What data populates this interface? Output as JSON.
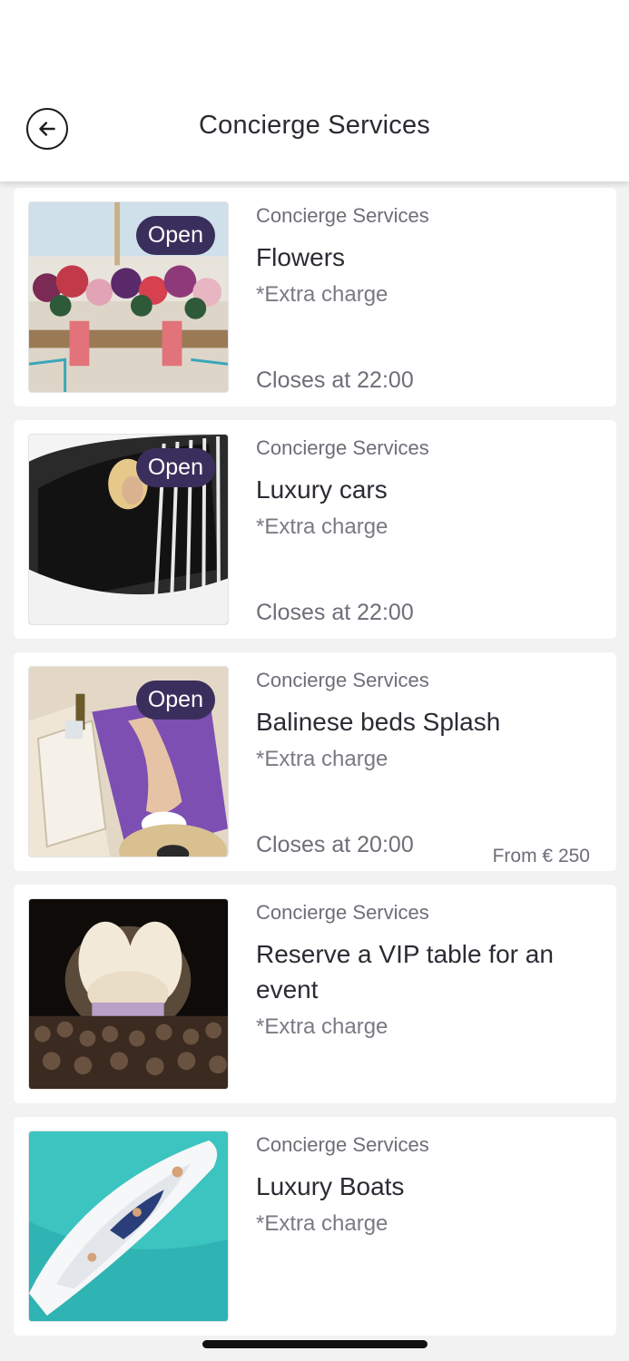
{
  "header": {
    "title": "Concierge Services",
    "back_icon": "arrow-left-circle-icon"
  },
  "items": [
    {
      "category": "Concierge Services",
      "name": "Flowers",
      "charge": "*Extra charge",
      "badge": "Open",
      "closes": "Closes at 22:00",
      "price": ""
    },
    {
      "category": "Concierge Services",
      "name": "Luxury cars",
      "charge": "*Extra charge",
      "badge": "Open",
      "closes": "Closes at 22:00",
      "price": ""
    },
    {
      "category": "Concierge Services",
      "name": "Balinese beds Splash",
      "charge": "*Extra charge",
      "badge": "Open",
      "closes": "Closes at 20:00",
      "price": "From € 250"
    },
    {
      "category": "Concierge Services",
      "name": "Reserve a VIP table for an event",
      "charge": "*Extra charge",
      "badge": "",
      "closes": "",
      "price": ""
    },
    {
      "category": "Concierge Services",
      "name": "Luxury Boats",
      "charge": "*Extra charge",
      "badge": "",
      "closes": "",
      "price": ""
    }
  ],
  "colors": {
    "badge_bg": "#3a2f5c",
    "text_primary": "#2b2b33",
    "text_secondary": "#6e6e78"
  }
}
